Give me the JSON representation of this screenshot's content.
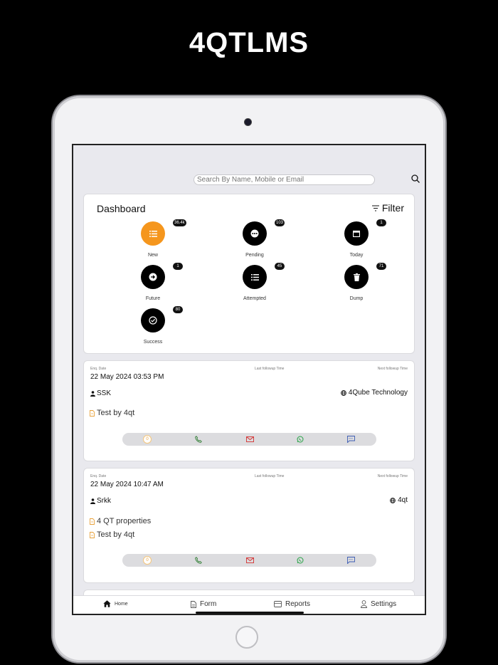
{
  "promo": {
    "title": "4QTLMS"
  },
  "search": {
    "placeholder": "Search By Name, Mobile or Email"
  },
  "dashboard": {
    "title": "Dashboard",
    "filter_label": "Filter",
    "tiles": [
      {
        "label": "New",
        "count": "36.4k"
      },
      {
        "label": "Pending",
        "count": "103"
      },
      {
        "label": "Today",
        "count": "1"
      },
      {
        "label": "Future",
        "count": "1"
      },
      {
        "label": "Attempted",
        "count": "45"
      },
      {
        "label": "Dump",
        "count": "71"
      },
      {
        "label": "Success",
        "count": "80"
      }
    ]
  },
  "labels": {
    "enq_date": "Enq. Date",
    "last_followup": "Last followup Time",
    "next_followup": "Next followup Time"
  },
  "leads": [
    {
      "date": "22 May 2024 03:53 PM",
      "name": "SSK",
      "company": "4Qube Technology",
      "notes": [
        "Test by 4qt"
      ],
      "count": "0"
    },
    {
      "date": "22 May 2024 10:47 AM",
      "name": "Srkk",
      "company": "4qt",
      "notes": [
        "4 QT properties",
        "Test by 4qt"
      ],
      "count": "0"
    }
  ],
  "tabs": [
    {
      "label": "Home"
    },
    {
      "label": "Form"
    },
    {
      "label": "Reports"
    },
    {
      "label": "Settings"
    }
  ],
  "colors": {
    "accent": "#f5961d",
    "call": "#2e7d32",
    "mail": "#d32f2f",
    "whatsapp": "#25a244",
    "sms": "#3b5bb3"
  }
}
